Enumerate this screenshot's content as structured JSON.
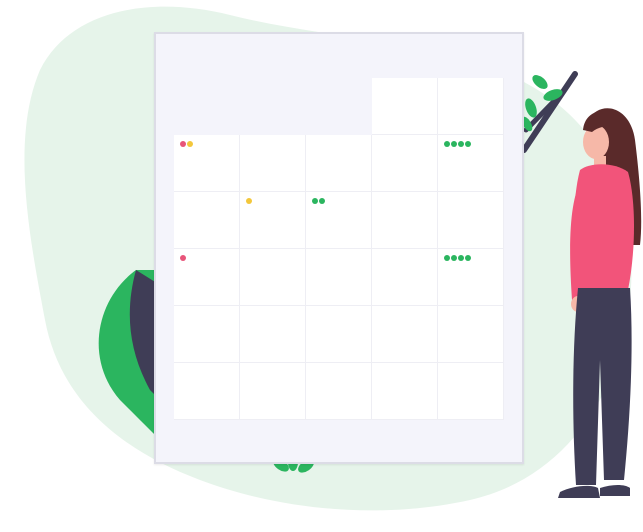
{
  "colors": {
    "blob": "#e6f4ea",
    "board_bg": "#f4f4fb",
    "board_border": "#dcdce6",
    "cell_bg": "#ffffff",
    "red_dot": "#e8557a",
    "yellow_dot": "#f3c73b",
    "green_dot": "#2bb55f",
    "leaf_green": "#2bb55f",
    "leaf_dark": "#3f3d56",
    "shirt": "#f2547a",
    "pants": "#3f3d56",
    "hair": "#5a2a2a",
    "skin": "#f6b8a8"
  },
  "calendar": {
    "events": [
      {
        "row": 0,
        "col": 0,
        "dots": [
          "red",
          "yellow"
        ]
      },
      {
        "row": 0,
        "col": 4,
        "dots": [
          "green",
          "green",
          "green",
          "green"
        ]
      },
      {
        "row": 1,
        "col": 1,
        "dots": [
          "yellow"
        ]
      },
      {
        "row": 1,
        "col": 2,
        "dots": [
          "green",
          "green"
        ]
      },
      {
        "row": 2,
        "col": 0,
        "dots": [
          "red"
        ]
      },
      {
        "row": 2,
        "col": 4,
        "dots": [
          "green",
          "green",
          "green",
          "green"
        ]
      }
    ]
  },
  "icons": {
    "illustration": "calendar-illustration-icon",
    "person": "woman-standing-icon",
    "plant_left": "leaf-plant-icon",
    "plant_right": "branch-leaves-icon",
    "plant_bottom": "sprout-icon"
  }
}
